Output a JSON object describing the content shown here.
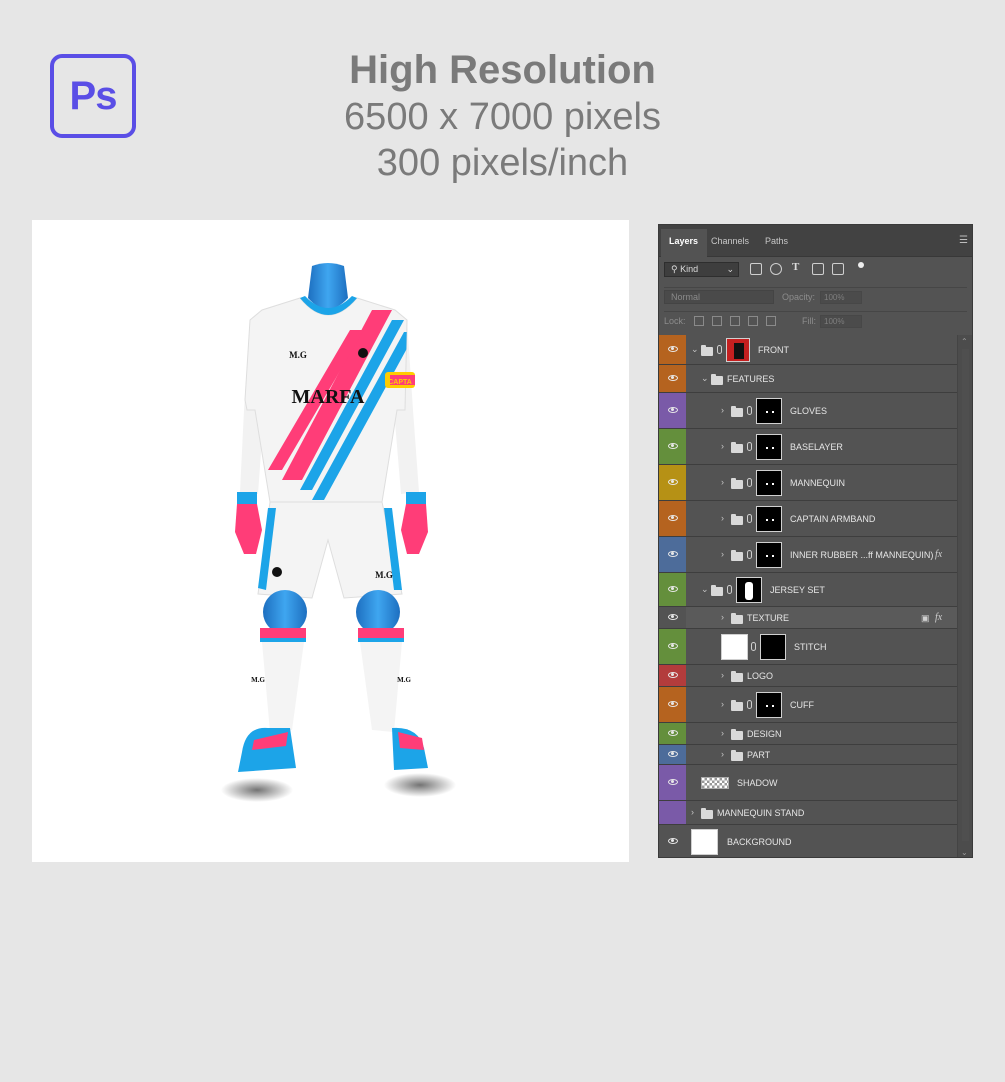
{
  "header": {
    "app_icon": "Ps",
    "title": "High Resolution",
    "dimensions": "6500 x 7000 pixels",
    "resolution": "300 pixels/inch"
  },
  "preview": {
    "jersey_brand": "MARFA",
    "initials": "M.G",
    "armband_text": "CAPTA",
    "colors": {
      "pink": "#ff3d78",
      "blue": "#1ca4e8",
      "mannequin": "#2589d8",
      "shirt": "#f2f2f2"
    }
  },
  "panel": {
    "tabs": [
      "Layers",
      "Channels",
      "Paths"
    ],
    "filter_kind": "Kind",
    "blend_mode": "Normal",
    "opacity_label": "Opacity:",
    "opacity_value": "100%",
    "lock_label": "Lock:",
    "fill_label": "Fill:",
    "fill_value": "100%",
    "menu_icon": "panel-menu-icon",
    "layers": [
      {
        "name": "FRONT",
        "color": "#b5631f"
      },
      {
        "name": "FEATURES",
        "color": "#b5631f"
      },
      {
        "name": "GLOVES",
        "color": "#7a5aa8"
      },
      {
        "name": "BASELAYER",
        "color": "#648f3c"
      },
      {
        "name": "MANNEQUIN",
        "color": "#b69115"
      },
      {
        "name": "CAPTAIN ARMBAND",
        "color": "#b5631f"
      },
      {
        "name": "INNER RUBBER ...ff MANNEQUIN)",
        "color": "#4d6c9a",
        "fx": "fx"
      },
      {
        "name": "JERSEY SET",
        "color": "#648f3c"
      },
      {
        "name": "TEXTURE",
        "color": "#535353",
        "fx": "fx"
      },
      {
        "name": "STITCH",
        "color": "#648f3c"
      },
      {
        "name": "LOGO",
        "color": "#b33c3c"
      },
      {
        "name": "CUFF",
        "color": "#b5631f"
      },
      {
        "name": "DESIGN",
        "color": "#648f3c"
      },
      {
        "name": "PART",
        "color": "#4d6c9a"
      },
      {
        "name": "SHADOW",
        "color": "#7a5aa8"
      },
      {
        "name": "MANNEQUIN STAND",
        "color": "#7a5aa8"
      },
      {
        "name": "BACKGROUND",
        "color": "#535353"
      }
    ]
  }
}
